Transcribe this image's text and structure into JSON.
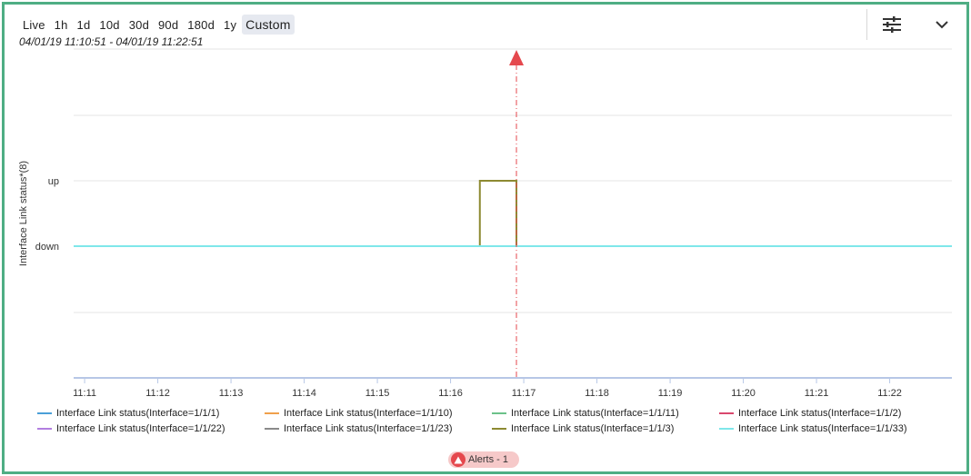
{
  "toolbar": {
    "ranges": [
      "Live",
      "1h",
      "1d",
      "10d",
      "30d",
      "90d",
      "180d",
      "1y",
      "Custom"
    ],
    "active_range": "Custom",
    "date_range": "04/01/19 11:10:51 - 04/01/19 11:22:51",
    "settings_icon": "sliders-icon",
    "collapse_icon": "chevron-down-icon"
  },
  "alerts": {
    "label": "Alerts - 1",
    "icon": "warning-triangle-icon",
    "color": "#e5484d"
  },
  "chart_data": {
    "type": "line",
    "ylabel": "Interface Link status*(8)",
    "y_categories": [
      "down",
      "up"
    ],
    "x_ticks": [
      "11:11",
      "11:12",
      "11:13",
      "11:14",
      "11:15",
      "11:16",
      "11:17",
      "11:18",
      "11:19",
      "11:20",
      "11:21",
      "11:22"
    ],
    "x_range": [
      "11:10:51",
      "11:22:51"
    ],
    "grid": true,
    "legend_position": "bottom",
    "series": [
      {
        "name": "Interface Link status(Interface=1/1/1)",
        "color": "#4a9fd8",
        "points": [
          [
            "11:10:51",
            "down"
          ],
          [
            "11:22:51",
            "down"
          ]
        ]
      },
      {
        "name": "Interface Link status(Interface=1/1/10)",
        "color": "#f0a04b",
        "points": [
          [
            "11:10:51",
            "down"
          ],
          [
            "11:22:51",
            "down"
          ]
        ]
      },
      {
        "name": "Interface Link status(Interface=1/1/11)",
        "color": "#6cc28a",
        "points": [
          [
            "11:10:51",
            "down"
          ],
          [
            "11:22:51",
            "down"
          ]
        ]
      },
      {
        "name": "Interface Link status(Interface=1/1/2)",
        "color": "#d9486e",
        "points": [
          [
            "11:10:51",
            "down"
          ],
          [
            "11:22:51",
            "down"
          ]
        ]
      },
      {
        "name": "Interface Link status(Interface=1/1/22)",
        "color": "#b27ee0",
        "points": [
          [
            "11:10:51",
            "down"
          ],
          [
            "11:22:51",
            "down"
          ]
        ]
      },
      {
        "name": "Interface Link status(Interface=1/1/23)",
        "color": "#8a8a8a",
        "points": [
          [
            "11:10:51",
            "down"
          ],
          [
            "11:22:51",
            "down"
          ]
        ]
      },
      {
        "name": "Interface Link status(Interface=1/1/3)",
        "color": "#8d8a32",
        "points": [
          [
            "11:10:51",
            "down"
          ],
          [
            "11:16:24",
            "down"
          ],
          [
            "11:16:24",
            "up"
          ],
          [
            "11:16:54",
            "up"
          ],
          [
            "11:16:54",
            "down"
          ],
          [
            "11:22:51",
            "down"
          ]
        ]
      },
      {
        "name": "Interface Link status(Interface=1/1/33)",
        "color": "#7fe7ea",
        "points": [
          [
            "11:10:51",
            "down"
          ],
          [
            "11:22:51",
            "down"
          ]
        ]
      }
    ],
    "alert_marker": {
      "x": "11:16:54",
      "color": "#e5484d"
    }
  }
}
